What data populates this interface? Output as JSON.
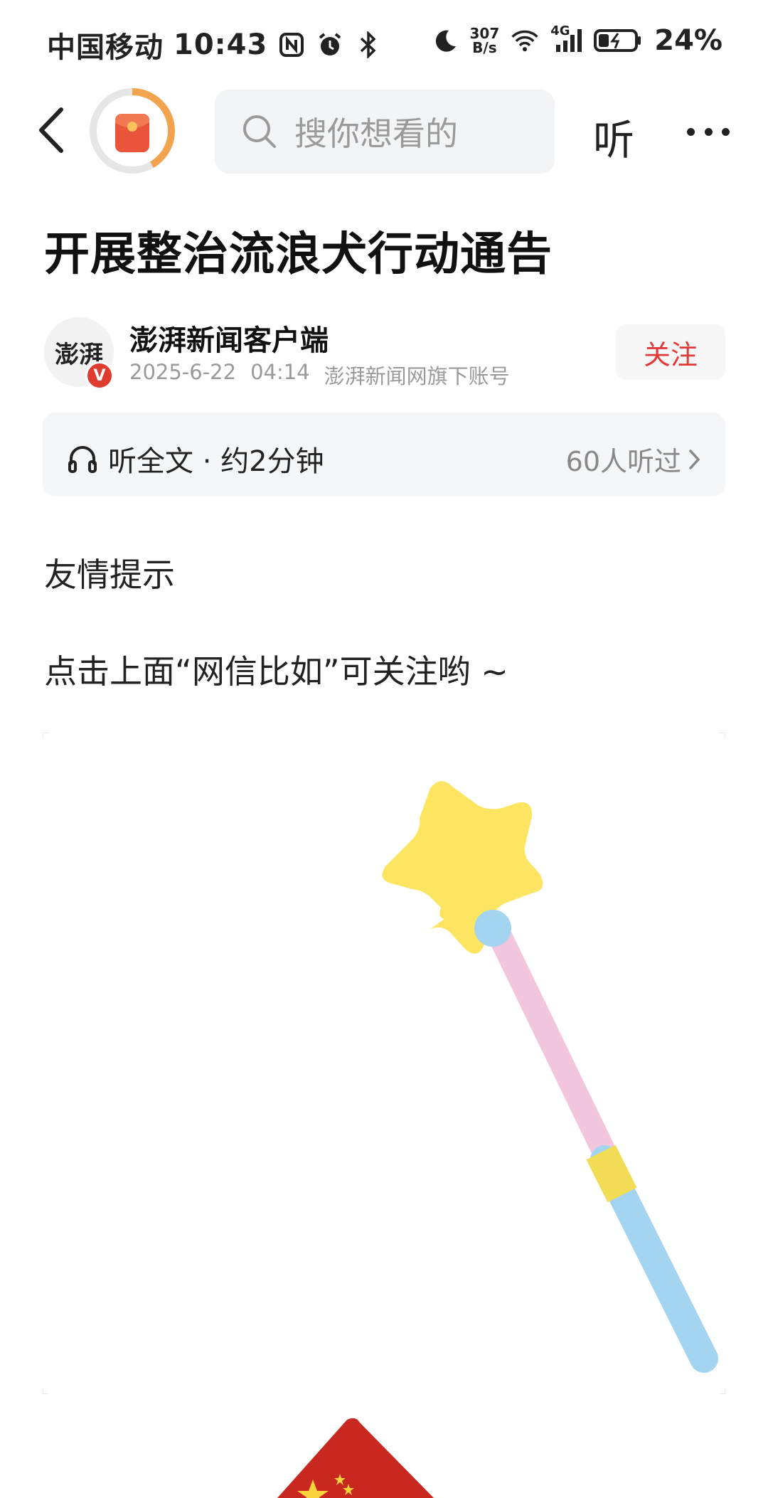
{
  "status_bar": {
    "carrier": "中国移动",
    "time": "10:43",
    "net_speed_top": "307",
    "net_speed_bottom": "B/s",
    "network": "4G",
    "battery": "24%"
  },
  "nav": {
    "search_placeholder": "搜你想看的",
    "listen_label": "听"
  },
  "article": {
    "title": "开展整治流浪犬行动通告",
    "author_logo_text": "澎湃",
    "author_name": "澎湃新闻客户端",
    "date": "2025-6-22",
    "clock": "04:14",
    "source": "澎湃新闻网旗下账号",
    "follow_label": "关注",
    "listen_full": "听全文 · 约2分钟",
    "listeners": "60人听过",
    "para1": "友情提示",
    "para2": "点击上面“网信比如”可关注哟 ~"
  },
  "colors": {
    "accent_red": "#e23a3a",
    "ring_orange": "#f2a34d",
    "star_yellow": "#fde562",
    "wand_pink": "#f3c6e0",
    "wand_blue": "#a3d4f0"
  }
}
